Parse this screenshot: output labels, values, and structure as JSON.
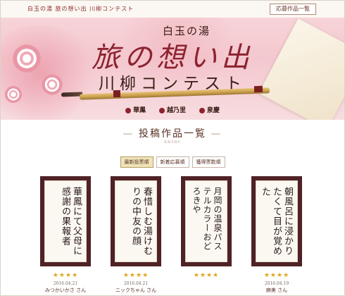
{
  "header": {
    "site_title": "白玉の湯 旅の想い出 川柳コンテスト",
    "list_button": "応募作品一覧"
  },
  "hero": {
    "subtitle": "白玉の湯",
    "title": "旅の想い出",
    "contest": "川柳コンテスト",
    "sponsors": [
      "華鳳",
      "越乃里",
      "泉慶"
    ]
  },
  "entries": {
    "title": "投稿作品一覧",
    "subtitle": "ENTRY",
    "tabs": [
      "最新投票順",
      "新着応募順",
      "獲得票数順"
    ],
    "active_tab": 0
  },
  "cards": [
    {
      "poem": "華鳳にて父母に感謝の果報者",
      "stars": "★★★★",
      "date": "2016.04.21",
      "author": "みつかいかさ さん"
    },
    {
      "poem": "春惜しむ湯けむりの中友の顔",
      "stars": "★★★★",
      "date": "2016.04.21",
      "author": "ニックちゃん さん"
    },
    {
      "poem": "月岡の温泉パステルカラーおどろきや",
      "stars": "★★★★",
      "date": "",
      "author": ""
    },
    {
      "poem": "朝風呂に浸かりたくて目が覚めた",
      "stars": "★★★★",
      "date": "2016.04.19",
      "author": "麻美 さん"
    }
  ],
  "colors": {
    "accent": "#8d2330",
    "frame": "#4f2226",
    "star": "#e0a51c",
    "hero_bg": "#f4c8cf"
  }
}
